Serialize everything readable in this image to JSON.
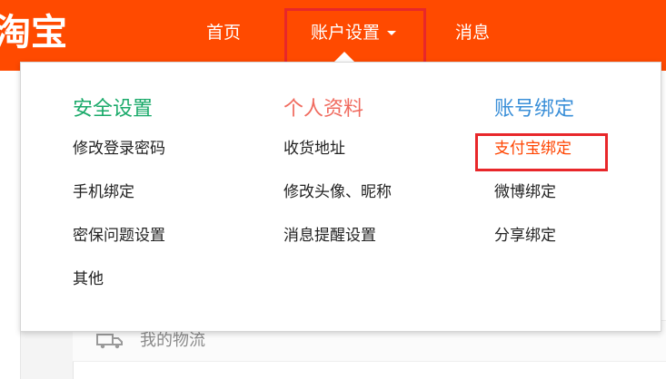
{
  "header": {
    "logo": "淘宝",
    "nav": {
      "home": "首页",
      "account_settings": "账户设置",
      "messages": "消息"
    }
  },
  "dropdown": {
    "security": {
      "title": "安全设置",
      "items": [
        "修改登录密码",
        "手机绑定",
        "密保问题设置",
        "其他"
      ]
    },
    "profile": {
      "title": "个人资料",
      "items": [
        "收货地址",
        "修改头像、昵称",
        "消息提醒设置"
      ]
    },
    "binding": {
      "title": "账号绑定",
      "items": [
        "支付宝绑定",
        "微博绑定",
        "分享绑定"
      ]
    }
  },
  "background": {
    "logistics_label": "我的物流"
  },
  "colors": {
    "brand_orange": "#ff4a00",
    "highlight_red": "#e8272a",
    "security_green": "#1aaa6a",
    "profile_red": "#f06a5e",
    "binding_blue": "#3a8fd8",
    "active_link": "#ff4400"
  },
  "icons": {
    "dropdown_caret": "caret-down-icon",
    "logistics": "truck-icon"
  }
}
